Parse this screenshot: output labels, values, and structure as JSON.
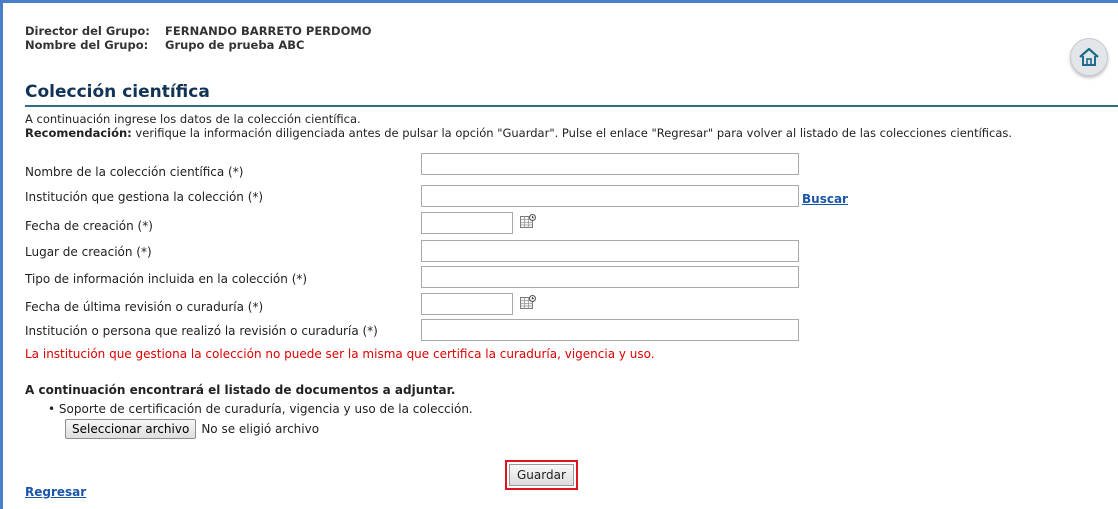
{
  "header": {
    "director_label": "Director del Grupo:",
    "director_value": "FERNANDO BARRETO PERDOMO",
    "group_label": "Nombre del Grupo:",
    "group_value": "Grupo de prueba ABC"
  },
  "icons": {
    "home": "home-icon",
    "calendar": "calendar-icon"
  },
  "page_title": "Colección científica",
  "intro": {
    "line1": "A continuación ingrese los datos de la colección científica.",
    "recommendation_label": "Recomendación:",
    "recommendation_text": " verifique la información diligenciada antes de pulsar la opción \"Guardar\". Pulse el enlace \"Regresar\" para volver al listado de las colecciones científicas."
  },
  "form": {
    "nombre_label": "Nombre de la colección científica (*)",
    "nombre_value": "",
    "institucion_label": "Institución que gestiona la colección (*)",
    "institucion_value": "",
    "buscar_link": "Buscar",
    "fecha_creacion_label": "Fecha de creación (*)",
    "fecha_creacion_value": "",
    "lugar_label": "Lugar de creación (*)",
    "lugar_value": "",
    "tipo_label": "Tipo de información incluida en la colección (*)",
    "tipo_value": "",
    "fecha_revision_label": "Fecha de última revisión o curaduría (*)",
    "fecha_revision_value": "",
    "revisor_label": "Institución o persona que realizó la revisión o curaduría (*)",
    "revisor_value": ""
  },
  "error_message": "La institución que gestiona la colección no puede ser la misma que certifica la curaduría, vigencia y uso.",
  "documents": {
    "title": "A continuación encontrará el listado de documentos a adjuntar.",
    "item": "Soporte de certificación de curaduría, vigencia y uso de la colección.",
    "file_button": "Seleccionar archivo",
    "file_status": "No se eligió archivo"
  },
  "actions": {
    "save": "Guardar",
    "back": "Regresar"
  },
  "colors": {
    "accent": "#4a7fc8",
    "error": "#e00000",
    "link": "#1a56a8",
    "highlight": "#e0141e"
  }
}
